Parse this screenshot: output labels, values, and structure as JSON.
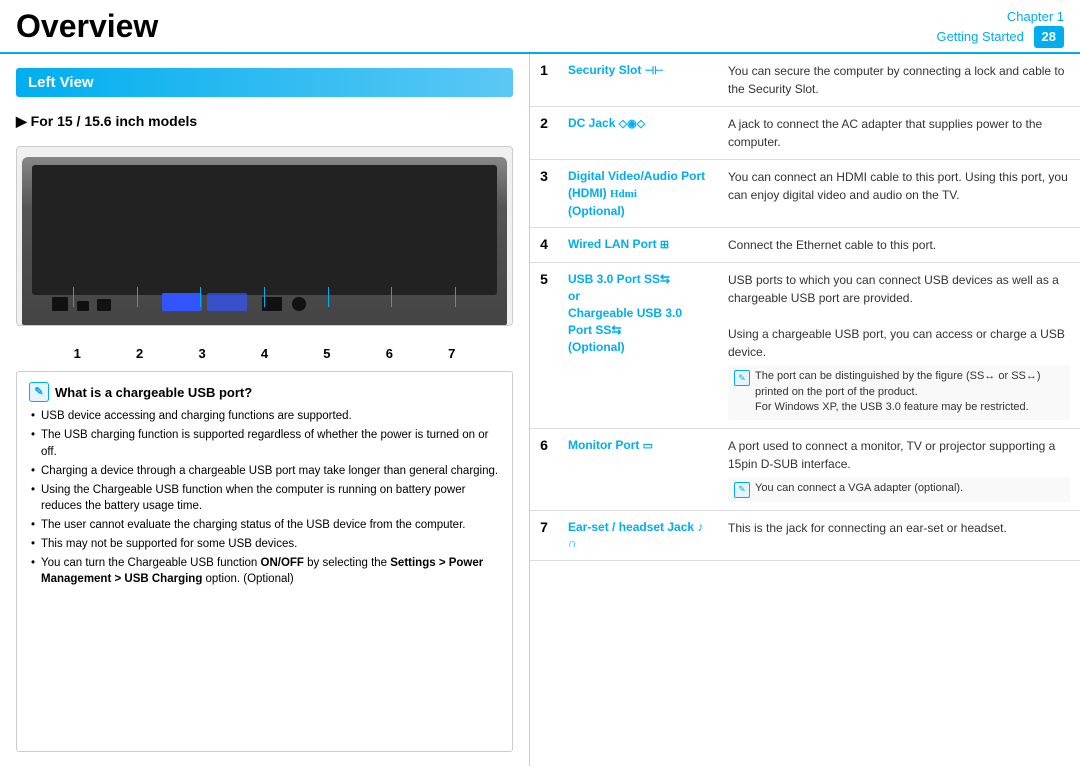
{
  "header": {
    "title": "Overview",
    "chapter_label": "Chapter 1",
    "chapter_sub": "Getting Started",
    "page_number": "28"
  },
  "left_panel": {
    "section_title": "Left View",
    "model_text": "For 15 / 15.6 inch models",
    "port_numbers": [
      "1",
      "2",
      "3",
      "4",
      "5",
      "6",
      "7"
    ],
    "note": {
      "title": "What is a chargeable USB port?",
      "items": [
        "USB device accessing and charging functions are supported.",
        "The USB charging function is supported regardless of whether the power is turned on or off.",
        "Charging a device through a chargeable USB port may take longer than general charging.",
        "Using the Chargeable USB function when the computer is running on battery power reduces the battery usage time.",
        "The user cannot evaluate the charging status of the USB device from the computer.",
        "This may not be supported for some USB devices.",
        "You can turn the Chargeable USB function ON/OFF by selecting the Settings > Power Management > USB Charging option. (Optional)"
      ],
      "bold_parts": [
        "ON/OFF",
        "Settings > Power Management > USB Charging"
      ]
    }
  },
  "right_panel": {
    "ports": [
      {
        "number": "1",
        "name": "Security Slot",
        "symbol": "⊣⊢",
        "description": "You can secure the computer by connecting a lock and cable to the Security Slot.",
        "notes": []
      },
      {
        "number": "2",
        "name": "DC Jack",
        "symbol": "◇◉◇",
        "description": "A jack to connect the AC adapter that supplies power to the computer.",
        "notes": []
      },
      {
        "number": "3",
        "name": "Digital Video/Audio Port (HDMI) (Optional)",
        "symbol": "Ηϖmι",
        "description": "You can connect an HDMI cable to this port. Using this port, you can enjoy digital video and audio on the TV.",
        "notes": []
      },
      {
        "number": "4",
        "name": "Wired LAN Port",
        "symbol": "⊞",
        "description": "Connect the Ethernet cable to this port.",
        "notes": []
      },
      {
        "number": "5",
        "name": "USB 3.0 Port or Chargeable USB 3.0 Port (Optional)",
        "symbol": "SS⇆",
        "description": "USB ports to which you can connect USB devices as well as a chargeable USB port are provided.\n\nUsing a chargeable USB port, you can access or charge a USB device.",
        "notes": [
          "The port can be distinguished by the figure (SS↔ or SS↔) printed on the port of the product. For Windows XP, the USB 3.0 feature may be restricted."
        ]
      },
      {
        "number": "6",
        "name": "Monitor Port",
        "symbol": "▭",
        "description": "A port used to connect a monitor, TV or projector supporting a 15pin D-SUB interface.",
        "notes": [
          "You can connect a VGA adapter (optional)."
        ]
      },
      {
        "number": "7",
        "name": "Ear-set / headset Jack",
        "symbol": "♪ ∩",
        "description": "This is the jack for connecting an ear-set or headset.",
        "notes": []
      }
    ]
  }
}
